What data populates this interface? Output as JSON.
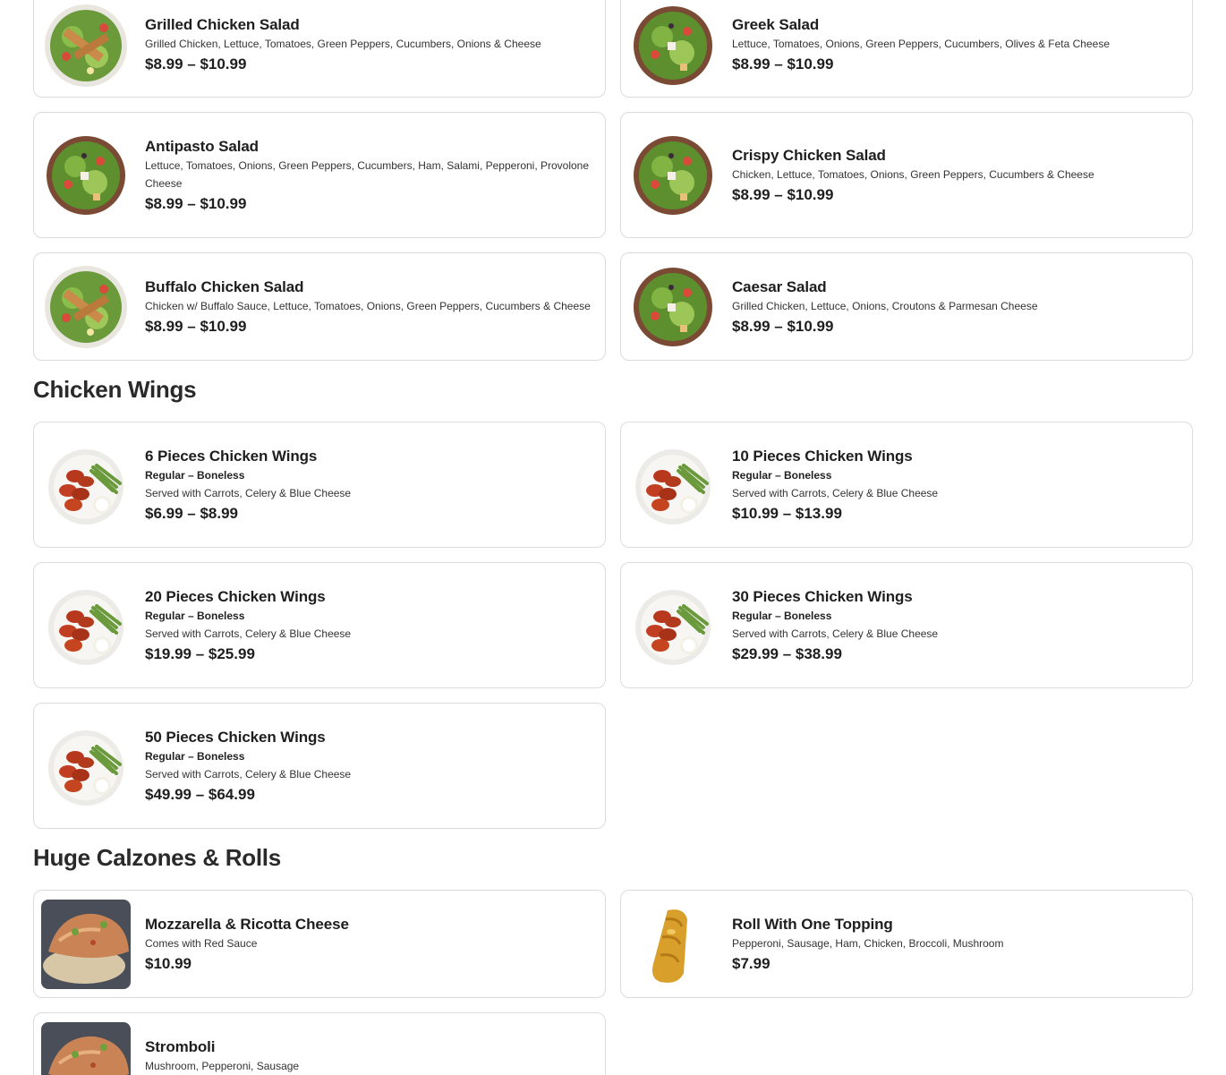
{
  "salads": [
    {
      "name": "Grilled Chicken Salad",
      "desc": "Grilled Chicken, Lettuce, Tomatoes, Green Peppers, Cucumbers, Onions & Cheese",
      "price": "$8.99 – $10.99",
      "icon": "salad-plate-icon"
    },
    {
      "name": "Greek Salad",
      "desc": "Lettuce, Tomatoes, Onions, Green Peppers, Cucumbers, Olives & Feta Cheese",
      "price": "$8.99 – $10.99",
      "icon": "salad-bowl-icon"
    },
    {
      "name": "Antipasto Salad",
      "desc": "Lettuce, Tomatoes, Onions, Green Peppers, Cucumbers, Ham, Salami, Pepperoni, Provolone Cheese",
      "price": "$8.99 – $10.99",
      "icon": "salad-bowl-icon"
    },
    {
      "name": "Crispy Chicken Salad",
      "desc": "Chicken, Lettuce, Tomatoes, Onions, Green Peppers, Cucumbers & Cheese",
      "price": "$8.99 – $10.99",
      "icon": "salad-bowl-icon"
    },
    {
      "name": "Buffalo Chicken Salad",
      "desc": "Chicken w/ Buffalo Sauce, Lettuce, Tomatoes, Onions, Green Peppers, Cucumbers & Cheese",
      "price": "$8.99 – $10.99",
      "icon": "salad-plate-icon"
    },
    {
      "name": "Caesar Salad",
      "desc": "Grilled Chicken, Lettuce, Onions, Croutons &  Parmesan Cheese",
      "price": "$8.99 – $10.99",
      "icon": "salad-bowl-icon"
    }
  ],
  "wings_section": {
    "title": "Chicken Wings",
    "items": [
      {
        "name": "6 Pieces Chicken Wings",
        "sub": "Regular – Boneless",
        "desc": "Served with Carrots, Celery & Blue Cheese",
        "price": "$6.99 – $8.99",
        "icon": "chicken-wings-icon"
      },
      {
        "name": "10 Pieces Chicken Wings",
        "sub": "Regular – Boneless",
        "desc": "Served with Carrots, Celery & Blue Cheese",
        "price": "$10.99 – $13.99",
        "icon": "chicken-wings-icon"
      },
      {
        "name": "20 Pieces Chicken Wings",
        "sub": "Regular – Boneless",
        "desc": "Served with Carrots, Celery & Blue Cheese",
        "price": "$19.99 – $25.99",
        "icon": "chicken-wings-icon"
      },
      {
        "name": "30 Pieces Chicken Wings",
        "sub": "Regular – Boneless",
        "desc": "Served with Carrots, Celery & Blue Cheese",
        "price": "$29.99 – $38.99",
        "icon": "chicken-wings-icon"
      },
      {
        "name": "50 Pieces Chicken Wings",
        "sub": "Regular – Boneless",
        "desc": "Served with Carrots, Celery & Blue Cheese",
        "price": "$49.99 – $64.99",
        "icon": "chicken-wings-icon"
      }
    ]
  },
  "calzones_section": {
    "title": "Huge Calzones & Rolls",
    "items": [
      {
        "name": "Mozzarella & Ricotta Cheese",
        "desc": "Comes with Red Sauce",
        "price": "$10.99",
        "icon": "calzone-icon"
      },
      {
        "name": "Roll With One Topping",
        "desc": "Pepperoni, Sausage, Ham, Chicken, Broccoli, Mushroom",
        "price": "$7.99",
        "icon": "roll-icon"
      },
      {
        "name": "Stromboli",
        "desc": "Mushroom, Pepperoni, Sausage",
        "price": "",
        "icon": "calzone-icon"
      }
    ]
  },
  "colors": {
    "card_border": "#dcdcdc",
    "text": "#1e1e1e",
    "background": "#ffffff"
  }
}
